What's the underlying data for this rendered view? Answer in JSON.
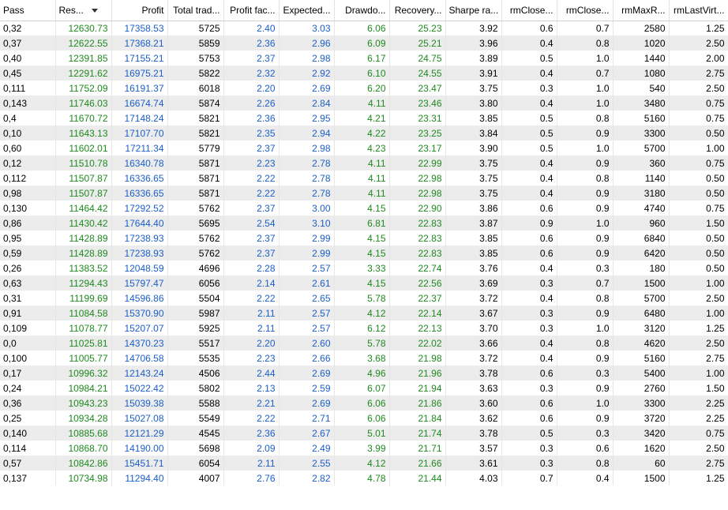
{
  "colors": {
    "green": "#1f8a1f",
    "blue": "#1c5fc8",
    "stripe": "#ececec"
  },
  "columns": [
    {
      "label": "Pass",
      "align": "left"
    },
    {
      "label": "Res...",
      "align": "left",
      "sorted": "desc"
    },
    {
      "label": "Profit"
    },
    {
      "label": "Total trad..."
    },
    {
      "label": "Profit fac..."
    },
    {
      "label": "Expected..."
    },
    {
      "label": "Drawdo..."
    },
    {
      "label": "Recovery..."
    },
    {
      "label": "Sharpe ra..."
    },
    {
      "label": "rmClose..."
    },
    {
      "label": "rmClose..."
    },
    {
      "label": "rmMaxR..."
    },
    {
      "label": "rmLastVirt..."
    }
  ],
  "column_colors": [
    "",
    "green",
    "blue",
    "",
    "blue",
    "blue",
    "green",
    "green",
    "",
    "",
    "",
    "",
    ""
  ],
  "rows": [
    [
      "0,32",
      "12630.73",
      "17358.53",
      "5725",
      "2.40",
      "3.03",
      "6.06",
      "25.23",
      "3.92",
      "0.6",
      "0.7",
      "2580",
      "1.25"
    ],
    [
      "0,37",
      "12622.55",
      "17368.21",
      "5859",
      "2.36",
      "2.96",
      "6.09",
      "25.21",
      "3.96",
      "0.4",
      "0.8",
      "1020",
      "2.50"
    ],
    [
      "0,40",
      "12391.85",
      "17155.21",
      "5753",
      "2.37",
      "2.98",
      "6.17",
      "24.75",
      "3.89",
      "0.5",
      "1.0",
      "1440",
      "2.00"
    ],
    [
      "0,45",
      "12291.62",
      "16975.21",
      "5822",
      "2.32",
      "2.92",
      "6.10",
      "24.55",
      "3.91",
      "0.4",
      "0.7",
      "1080",
      "2.75"
    ],
    [
      "0,111",
      "11752.09",
      "16191.37",
      "6018",
      "2.20",
      "2.69",
      "6.20",
      "23.47",
      "3.75",
      "0.3",
      "1.0",
      "540",
      "2.50"
    ],
    [
      "0,143",
      "11746.03",
      "16674.74",
      "5874",
      "2.26",
      "2.84",
      "4.11",
      "23.46",
      "3.80",
      "0.4",
      "1.0",
      "3480",
      "0.75"
    ],
    [
      "0,4",
      "11670.72",
      "17148.24",
      "5821",
      "2.36",
      "2.95",
      "4.21",
      "23.31",
      "3.85",
      "0.5",
      "0.8",
      "5160",
      "0.75"
    ],
    [
      "0,10",
      "11643.13",
      "17107.70",
      "5821",
      "2.35",
      "2.94",
      "4.22",
      "23.25",
      "3.84",
      "0.5",
      "0.9",
      "3300",
      "0.50"
    ],
    [
      "0,60",
      "11602.01",
      "17211.34",
      "5779",
      "2.37",
      "2.98",
      "4.23",
      "23.17",
      "3.90",
      "0.5",
      "1.0",
      "5700",
      "1.00"
    ],
    [
      "0,12",
      "11510.78",
      "16340.78",
      "5871",
      "2.23",
      "2.78",
      "4.11",
      "22.99",
      "3.75",
      "0.4",
      "0.9",
      "360",
      "0.75"
    ],
    [
      "0,112",
      "11507.87",
      "16336.65",
      "5871",
      "2.22",
      "2.78",
      "4.11",
      "22.98",
      "3.75",
      "0.4",
      "0.8",
      "1140",
      "0.50"
    ],
    [
      "0,98",
      "11507.87",
      "16336.65",
      "5871",
      "2.22",
      "2.78",
      "4.11",
      "22.98",
      "3.75",
      "0.4",
      "0.9",
      "3180",
      "0.50"
    ],
    [
      "0,130",
      "11464.42",
      "17292.52",
      "5762",
      "2.37",
      "3.00",
      "4.15",
      "22.90",
      "3.86",
      "0.6",
      "0.9",
      "4740",
      "0.75"
    ],
    [
      "0,86",
      "11430.42",
      "17644.40",
      "5695",
      "2.54",
      "3.10",
      "6.81",
      "22.83",
      "3.87",
      "0.9",
      "1.0",
      "960",
      "1.50"
    ],
    [
      "0,95",
      "11428.89",
      "17238.93",
      "5762",
      "2.37",
      "2.99",
      "4.15",
      "22.83",
      "3.85",
      "0.6",
      "0.9",
      "6840",
      "0.50"
    ],
    [
      "0,59",
      "11428.89",
      "17238.93",
      "5762",
      "2.37",
      "2.99",
      "4.15",
      "22.83",
      "3.85",
      "0.6",
      "0.9",
      "6420",
      "0.50"
    ],
    [
      "0,26",
      "11383.52",
      "12048.59",
      "4696",
      "2.28",
      "2.57",
      "3.33",
      "22.74",
      "3.76",
      "0.4",
      "0.3",
      "180",
      "0.50"
    ],
    [
      "0,63",
      "11294.43",
      "15797.47",
      "6056",
      "2.14",
      "2.61",
      "4.15",
      "22.56",
      "3.69",
      "0.3",
      "0.7",
      "1500",
      "1.00"
    ],
    [
      "0,31",
      "11199.69",
      "14596.86",
      "5504",
      "2.22",
      "2.65",
      "5.78",
      "22.37",
      "3.72",
      "0.4",
      "0.8",
      "5700",
      "2.50"
    ],
    [
      "0,91",
      "11084.58",
      "15370.90",
      "5987",
      "2.11",
      "2.57",
      "4.12",
      "22.14",
      "3.67",
      "0.3",
      "0.9",
      "6480",
      "1.00"
    ],
    [
      "0,109",
      "11078.77",
      "15207.07",
      "5925",
      "2.11",
      "2.57",
      "6.12",
      "22.13",
      "3.70",
      "0.3",
      "1.0",
      "3120",
      "1.25"
    ],
    [
      "0,0",
      "11025.81",
      "14370.23",
      "5517",
      "2.20",
      "2.60",
      "5.78",
      "22.02",
      "3.66",
      "0.4",
      "0.8",
      "4620",
      "2.50"
    ],
    [
      "0,100",
      "11005.77",
      "14706.58",
      "5535",
      "2.23",
      "2.66",
      "3.68",
      "21.98",
      "3.72",
      "0.4",
      "0.9",
      "5160",
      "2.75"
    ],
    [
      "0,17",
      "10996.32",
      "12143.24",
      "4506",
      "2.44",
      "2.69",
      "4.96",
      "21.96",
      "3.78",
      "0.6",
      "0.3",
      "5400",
      "1.00"
    ],
    [
      "0,24",
      "10984.21",
      "15022.42",
      "5802",
      "2.13",
      "2.59",
      "6.07",
      "21.94",
      "3.63",
      "0.3",
      "0.9",
      "2760",
      "1.50"
    ],
    [
      "0,36",
      "10943.23",
      "15039.38",
      "5588",
      "2.21",
      "2.69",
      "6.06",
      "21.86",
      "3.60",
      "0.6",
      "1.0",
      "3300",
      "2.25"
    ],
    [
      "0,25",
      "10934.28",
      "15027.08",
      "5549",
      "2.22",
      "2.71",
      "6.06",
      "21.84",
      "3.62",
      "0.6",
      "0.9",
      "3720",
      "2.25"
    ],
    [
      "0,140",
      "10885.68",
      "12121.29",
      "4545",
      "2.36",
      "2.67",
      "5.01",
      "21.74",
      "3.78",
      "0.5",
      "0.3",
      "3420",
      "0.75"
    ],
    [
      "0,114",
      "10868.70",
      "14190.00",
      "5698",
      "2.09",
      "2.49",
      "3.99",
      "21.71",
      "3.57",
      "0.3",
      "0.6",
      "1620",
      "2.50"
    ],
    [
      "0,57",
      "10842.86",
      "15451.71",
      "6054",
      "2.11",
      "2.55",
      "4.12",
      "21.66",
      "3.61",
      "0.3",
      "0.8",
      "60",
      "2.75"
    ],
    [
      "0,137",
      "10734.98",
      "11294.40",
      "4007",
      "2.76",
      "2.82",
      "4.78",
      "21.44",
      "4.03",
      "0.7",
      "0.4",
      "1500",
      "1.25"
    ]
  ]
}
